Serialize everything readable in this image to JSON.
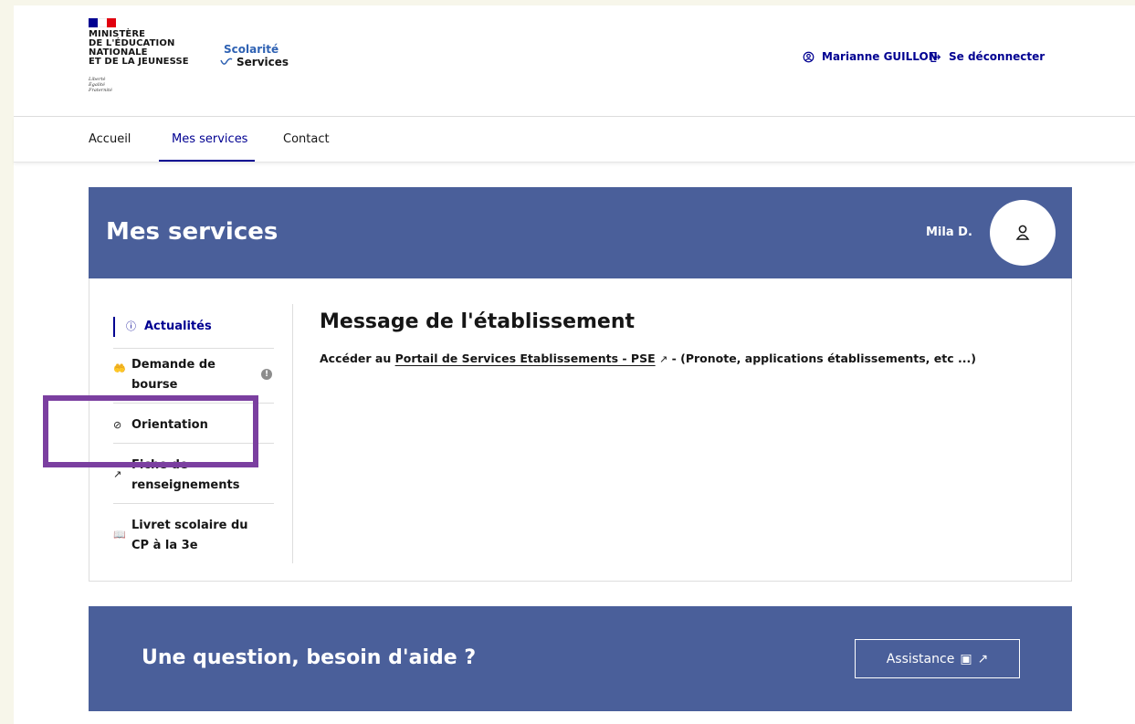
{
  "header": {
    "ministry_lines": [
      "MINISTÈRE",
      "DE L'ÉDUCATION",
      "NATIONALE",
      "ET DE LA JEUNESSE"
    ],
    "devise_lines": [
      "Liberté",
      "Égalité",
      "Fraternité"
    ],
    "service_line1": "Scolarité",
    "service_line2": "Services",
    "user_name": "Marianne GUILLON",
    "logout_label": "Se déconnecter"
  },
  "nav": {
    "items": [
      {
        "label": "Accueil"
      },
      {
        "label": "Mes services"
      },
      {
        "label": "Contact"
      }
    ],
    "active_index": 1
  },
  "main": {
    "title": "Mes services",
    "student_name": "Mila D.",
    "menu": [
      {
        "label": "Actualités",
        "icon": "info-circle-icon"
      },
      {
        "label_lines": [
          "Demande de",
          "bourse"
        ],
        "icon": "hand-coins-icon",
        "badge": "!"
      },
      {
        "label": "Orientation",
        "icon": "compass-icon"
      },
      {
        "label_lines": [
          "Fiche de",
          "renseignements"
        ],
        "icon": "external-link-icon"
      },
      {
        "label_lines": [
          "Livret scolaire du",
          "CP à la 3e"
        ],
        "icon": "book-open-icon"
      }
    ],
    "message_title": "Message de l'établissement",
    "message_prefix": "Accéder au",
    "message_link": "Portail de Services Etablissements - PSE",
    "message_suffix": "- (Pronote, applications établissements, etc ...)"
  },
  "help": {
    "title": "Une question, besoin d'aide ?",
    "button_label": "Assistance"
  },
  "colors": {
    "primary_blue": "#000091",
    "banner_blue": "#4a5f9a",
    "highlight_purple": "#7b3fa0",
    "background": "#f7f6ea"
  }
}
